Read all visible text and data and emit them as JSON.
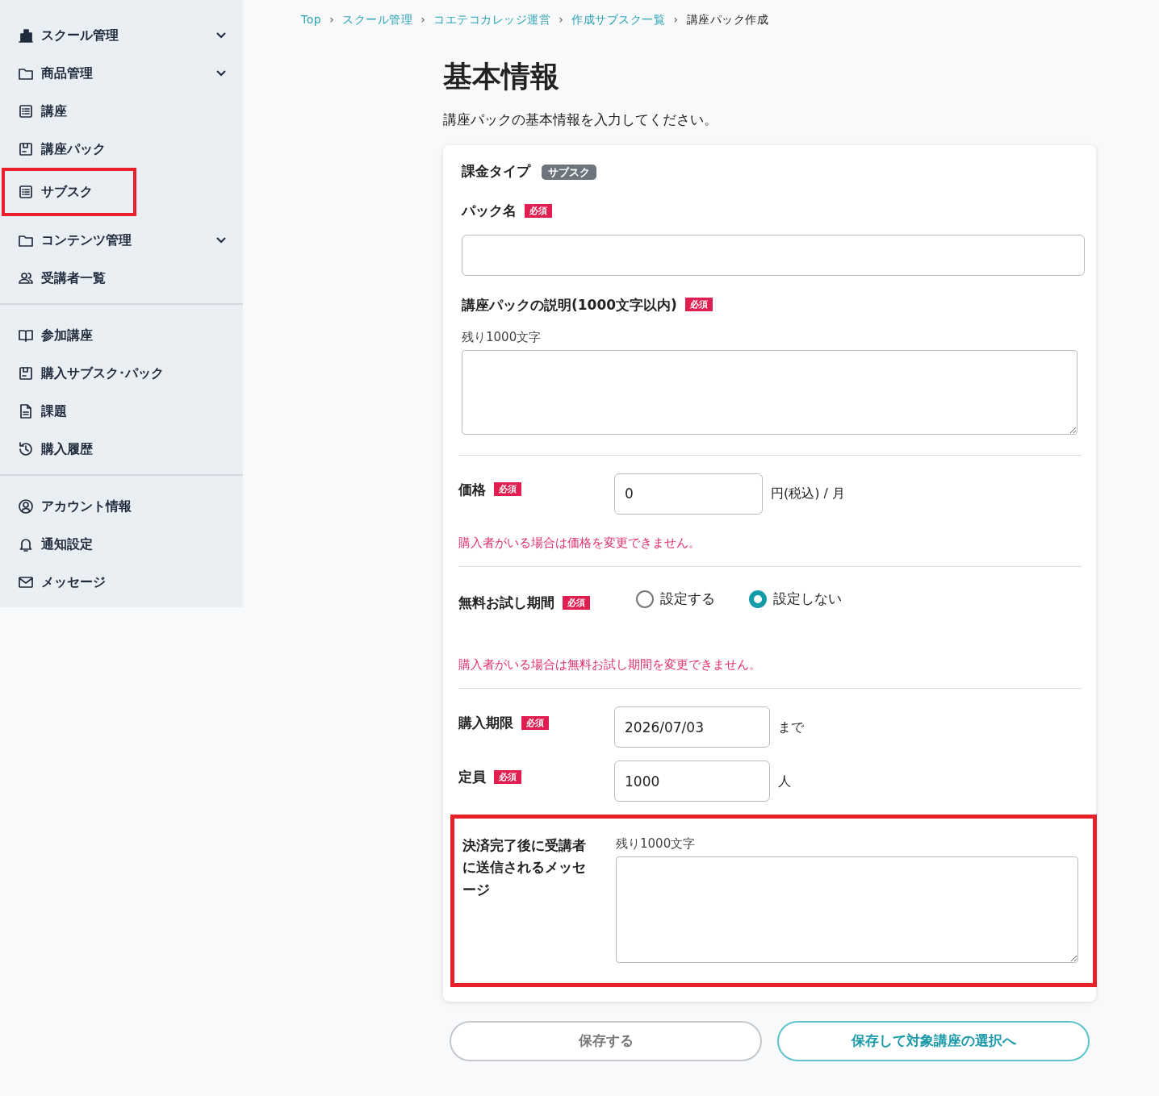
{
  "sidebar": {
    "groups": [
      {
        "items": [
          {
            "label": "スクール管理",
            "submenu": true,
            "highlighted": false
          },
          {
            "label": "商品管理",
            "submenu": true,
            "highlighted": false
          },
          {
            "label": "講座",
            "submenu": false,
            "highlighted": false
          },
          {
            "label": "講座パック",
            "submenu": false,
            "highlighted": false
          },
          {
            "label": "サブスク",
            "submenu": false,
            "highlighted": true
          },
          {
            "label": "コンテンツ管理",
            "submenu": true,
            "highlighted": false
          },
          {
            "label": "受講者一覧",
            "submenu": false,
            "highlighted": false
          }
        ]
      },
      {
        "items": [
          {
            "label": "参加講座",
            "submenu": false,
            "highlighted": false
          },
          {
            "label": "購入サブスク･パック",
            "submenu": false,
            "highlighted": false
          },
          {
            "label": "課題",
            "submenu": false,
            "highlighted": false
          },
          {
            "label": "購入履歴",
            "submenu": false,
            "highlighted": false
          }
        ]
      },
      {
        "items": [
          {
            "label": "アカウント情報",
            "submenu": false,
            "highlighted": false
          },
          {
            "label": "通知設定",
            "submenu": false,
            "highlighted": false
          },
          {
            "label": "メッセージ",
            "submenu": false,
            "highlighted": false
          }
        ]
      }
    ]
  },
  "breadcrumb": [
    {
      "label": "Top",
      "current": false
    },
    {
      "label": "スクール管理",
      "current": false
    },
    {
      "label": "コエテコカレッジ運営",
      "current": false
    },
    {
      "label": "作成サブスク一覧",
      "current": false
    },
    {
      "label": "講座パック作成",
      "current": true
    }
  ],
  "breadcrumb_separator": "›",
  "title": "基本情報",
  "subtitle": "講座パックの基本情報を入力してください。",
  "sections": [
    {
      "kind": "badge",
      "label": "課金タイプ",
      "badge": "サブスク",
      "divider": false,
      "highlighted": false
    },
    {
      "kind": "text",
      "label": "パック名",
      "required": "必須",
      "divider": false,
      "highlighted": false
    },
    {
      "kind": "textarea",
      "label": "講座パックの説明(1000文字以内)",
      "required": "必須",
      "counter": "残り1000文字",
      "divider": false,
      "highlighted": false
    },
    {
      "kind": "inline",
      "label": "価格",
      "required": "必須",
      "value": "0",
      "unit": "円(税込) / 月",
      "note": "購入者がいる場合は価格を変更できません。",
      "divider": true,
      "highlighted": false
    },
    {
      "kind": "radio",
      "label": "無料お試し期間",
      "required": "必須",
      "options": [
        {
          "label": "設定する",
          "selected": false
        },
        {
          "label": "設定しない",
          "selected": true
        }
      ],
      "note": "購入者がいる場合は無料お試し期間を変更できません。",
      "divider": true,
      "highlighted": false
    },
    {
      "kind": "inline",
      "label": "購入期限",
      "required": "必須",
      "value": "2026/07/03",
      "unit": "まで",
      "divider": true,
      "highlighted": false
    },
    {
      "kind": "inline",
      "label": "定員",
      "required": "必須",
      "value": "1000",
      "unit": "人",
      "divider": false,
      "highlighted": false
    },
    {
      "kind": "side_textarea",
      "label": "決済完了後に受講者に送信されるメッセージ",
      "counter": "残り1000文字",
      "divider": false,
      "highlighted": true
    }
  ],
  "buttons": [
    {
      "label": "保存する",
      "kind": "secondary"
    },
    {
      "label": "保存して対象講座の選択へ",
      "kind": "primary"
    }
  ]
}
